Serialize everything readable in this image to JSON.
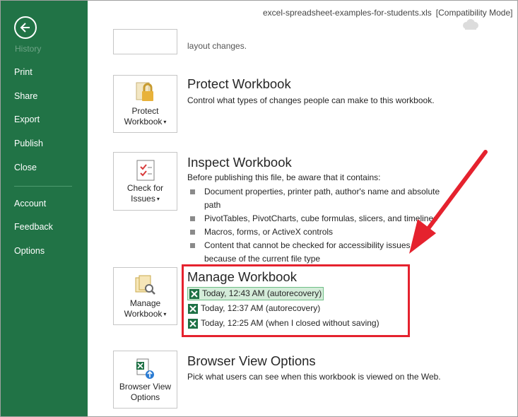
{
  "window": {
    "filename": "excel-spreadsheet-examples-for-students.xls",
    "mode": "[Compatibility Mode]"
  },
  "sidebar": {
    "history_label": "History",
    "items": [
      {
        "label": "Print"
      },
      {
        "label": "Share"
      },
      {
        "label": "Export"
      },
      {
        "label": "Publish"
      },
      {
        "label": "Close"
      },
      {
        "label": "Account"
      },
      {
        "label": "Feedback"
      },
      {
        "label": "Options"
      }
    ]
  },
  "top_partial_text": "layout changes.",
  "protect": {
    "button_line1": "Protect",
    "button_line2": "Workbook",
    "title": "Protect Workbook",
    "description": "Control what types of changes people can make to this workbook."
  },
  "inspect": {
    "button_line1": "Check for",
    "button_line2": "Issues",
    "title": "Inspect Workbook",
    "description": "Before publishing this file, be aware that it contains:",
    "bullets": [
      "Document properties, printer path, author's name and absolute path",
      "PivotTables, PivotCharts, cube formulas, slicers, and timelines",
      "Macros, forms, or ActiveX controls",
      "Content that cannot be checked for accessibility issues because of the current file type"
    ]
  },
  "manage": {
    "button_line1": "Manage",
    "button_line2": "Workbook",
    "title": "Manage Workbook",
    "versions": [
      "Today, 12:43 AM (autorecovery)",
      "Today, 12:37 AM (autorecovery)",
      "Today, 12:25 AM (when I closed without saving)"
    ]
  },
  "browser": {
    "button_line1": "Browser View",
    "button_line2": "Options",
    "title": "Browser View Options",
    "description": "Pick what users can see when this workbook is viewed on the Web."
  },
  "colors": {
    "sidebar": "#217346",
    "highlight": "#e5222e"
  }
}
